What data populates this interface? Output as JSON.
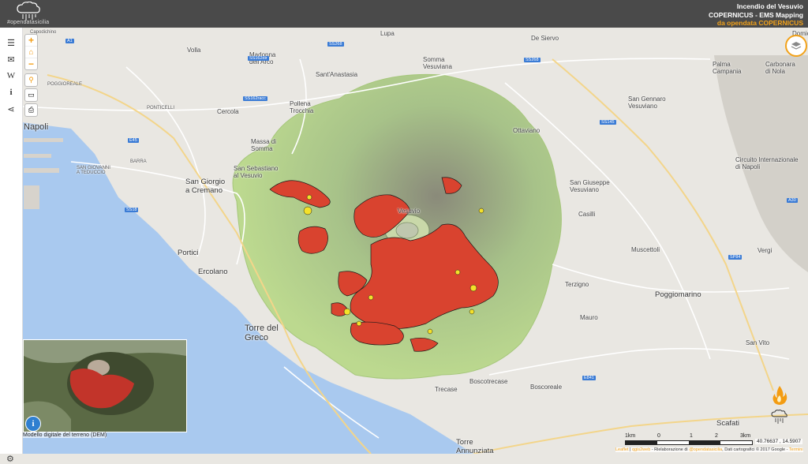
{
  "header": {
    "brand": "#opendatasicilia",
    "title1": "Incendio del Vesuvio",
    "title2": "COPERNICUS - EMS Mapping",
    "title3_prefix": "da opendata ",
    "title3_brand": "COPERNICUS"
  },
  "sidebar": {
    "icons": [
      "menu-icon",
      "mail-icon",
      "wikipedia-icon",
      "info-icon",
      "share-icon"
    ],
    "glyphs": [
      "☰",
      "✉",
      "W",
      "i",
      "⋖"
    ]
  },
  "zoom": {
    "in": "+",
    "out": "−"
  },
  "places": {
    "napoli": "Napoli",
    "san_giorgio": "San Giorgio\na Cremano",
    "portici": "Portici",
    "ercolano": "Ercolano",
    "torre_del_greco": "Torre del\nGreco",
    "torre_annunziata": "Torre\nAnnunziata",
    "boscotrecase": "Boscotrecase",
    "boscoreale": "Boscoreale",
    "trecase": "Trecase",
    "terzigno": "Terzigno",
    "san_giuseppe": "San Giuseppe\nVesuviano",
    "ottaviano": "Ottaviano",
    "somma": "Somma\nVesuviana",
    "sant_anastasia": "Sant'Anastasia",
    "pollena": "Pollena\nTrocchia",
    "massa": "Massa di\nSomma",
    "san_sebastiano": "San Sebastiano\nal Vesuvio",
    "cercola": "Cercola",
    "volla": "Volla",
    "ponticelli": "PONTICELLI",
    "barra": "BARRA",
    "san_giovanni": "SAN GIOVANNI\nA TEDUCCIO",
    "poggioreale": "POGGIOREALE",
    "capodichino": "Capodichino",
    "casilli": "Casilli",
    "muscettoli": "Muscettoli",
    "poggiomarino": "Poggiomarino",
    "san_gennaro": "San Gennaro\nVesuviano",
    "palma": "Palma\nCampania",
    "carbonara": "Carbonara\ndi Nola",
    "circuito": "Circuito Internazionale\ndi Napoli",
    "scafati": "Scafati",
    "san_vito": "San Vito",
    "de_siervo": "De Siervo",
    "lupa": "Lupa",
    "madonna_arco": "Madonna\ndell'Arco",
    "vesuvio": "Vesuvio",
    "mauro": "Mauro",
    "vergi": "Vergi",
    "domicella": "Domic"
  },
  "roads": [
    "SS268",
    "SS162dir",
    "SS162racc",
    "E45",
    "SS18",
    "SS145",
    "E841",
    "SS268",
    "SP84",
    "A1",
    "A30",
    "E45",
    "SS268"
  ],
  "inset": {
    "label": "Modello digitale del terreno (DEM)"
  },
  "scale": {
    "km1": "1km",
    "zero": "0",
    "one": "1",
    "two": "2",
    "three": "3km"
  },
  "coords": "40.76637 , 14.5907",
  "attribution": {
    "leaflet": "Leaflet",
    "qgis": "qgis2web",
    "mid": " - Rielaborazione di ",
    "author": "@opendatasicilia",
    "end": ", Dati cartografici © 2017 Google - ",
    "terms": "Termini"
  },
  "colors": {
    "burned": "#d9432f",
    "burned_edge": "#1a1a1a",
    "partially_burned": "#f4e12a",
    "park": "#b9d98e",
    "sea": "#a9c9ef",
    "accent": "#f2a21a",
    "header": "#4a4a4a"
  }
}
